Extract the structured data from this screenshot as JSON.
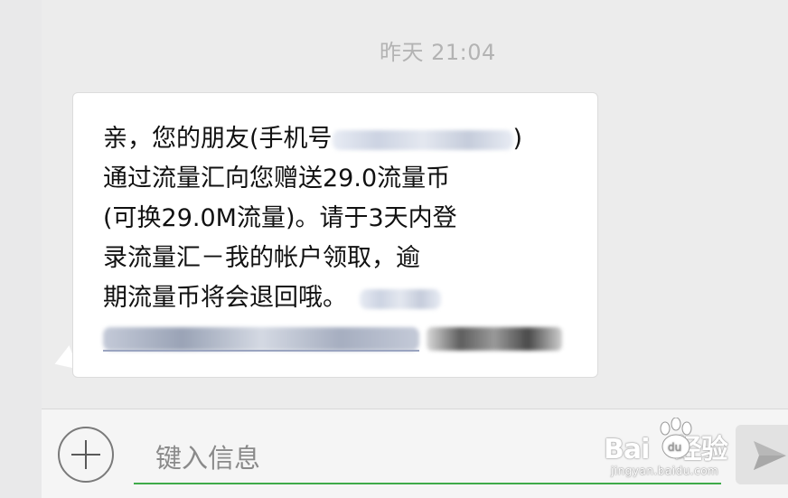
{
  "chat": {
    "timestamp": "昨天 21:04",
    "message": {
      "line1": "亲，您的朋友(手机号",
      "line1_end": ")",
      "line2": "通过流量汇向您赠送29.0流量币",
      "line3": "(可换29.0M流量)。请于3天内登",
      "line4": "录流量汇－我的帐户领取，逾",
      "line5": "期流量币将会退回哦。"
    }
  },
  "composer": {
    "placeholder": "键入信息"
  },
  "icons": {
    "add": "plus-circle-icon",
    "send": "send-arrow-icon"
  },
  "colors": {
    "accent_underline": "#3fab4a",
    "bubble": "#ffffff",
    "background": "#ececec"
  }
}
